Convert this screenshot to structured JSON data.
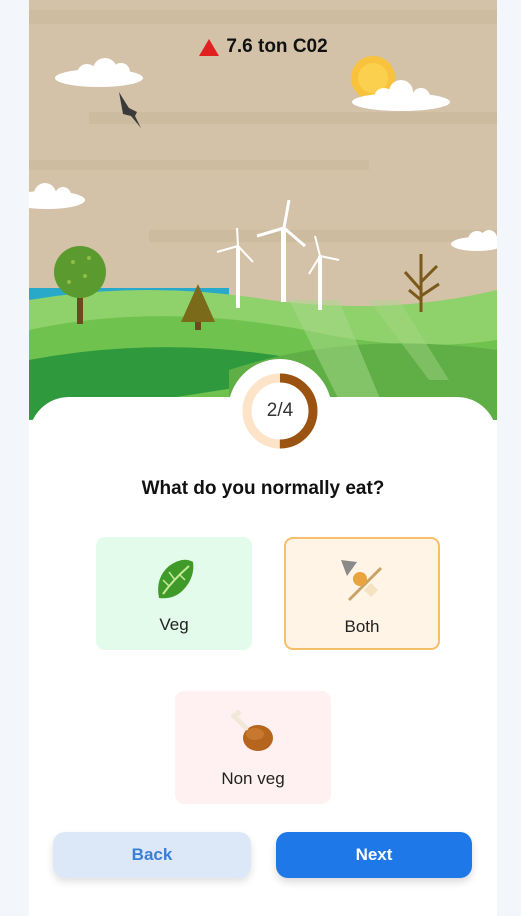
{
  "emissions": {
    "value": "7.6 ton C02",
    "icon": "warning-triangle-icon",
    "icon_color": "#e02020"
  },
  "progress": {
    "text": "2/4",
    "fraction": 0.5,
    "track_color": "#fde3c8",
    "fill_color": "#9b5312"
  },
  "question": "What do you normally eat?",
  "options": [
    {
      "label": "Veg",
      "icon": "leafy-green-icon",
      "selected": false
    },
    {
      "label": "Both",
      "icon": "oden-skewer-icon",
      "selected": true
    },
    {
      "label": "Non veg",
      "icon": "poultry-leg-icon",
      "selected": false
    }
  ],
  "buttons": {
    "back": "Back",
    "next": "Next"
  },
  "colors": {
    "accent": "#1f78e8",
    "selected_border": "#f6c06a"
  }
}
